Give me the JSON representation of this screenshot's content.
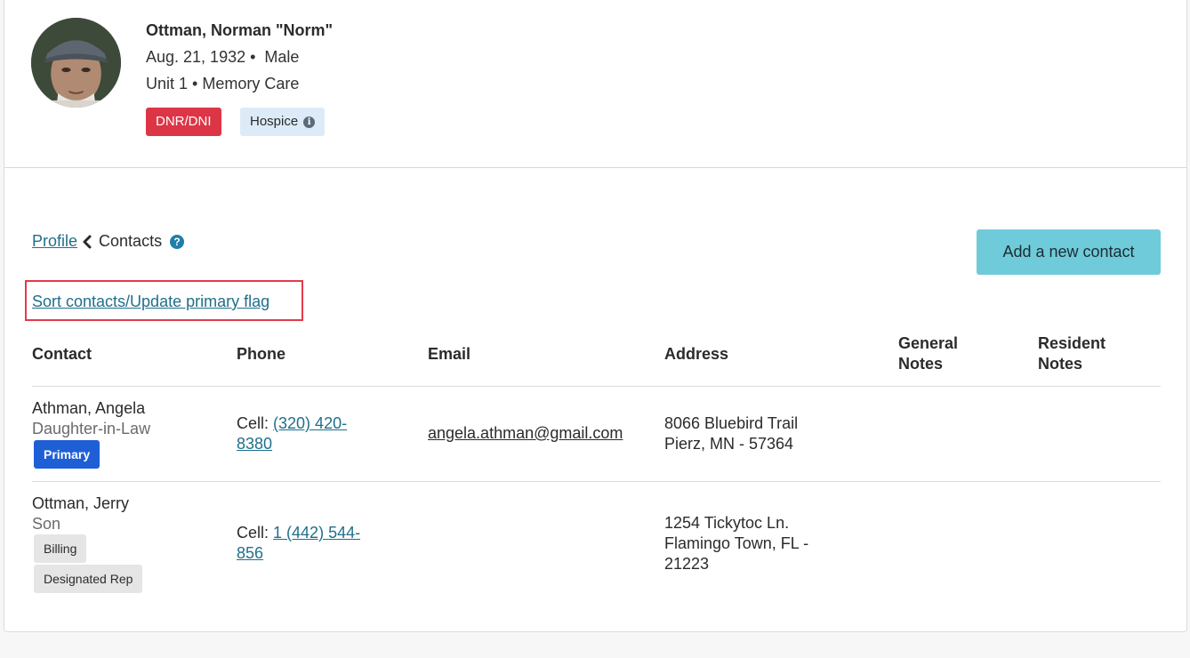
{
  "resident": {
    "name": "Ottman, Norman \"Norm\"",
    "dob": "Aug. 21, 1932",
    "sex": "Male",
    "location": "Unit 1 • Memory Care",
    "tags": {
      "dnr": "DNR/DNI",
      "hospice": "Hospice"
    }
  },
  "breadcrumb": {
    "parent": "Profile",
    "current": "Contacts"
  },
  "actions": {
    "add_contact": "Add a new contact",
    "sort": "Sort contacts/Update primary flag"
  },
  "table": {
    "headers": {
      "contact": "Contact",
      "phone": "Phone",
      "email": "Email",
      "address": "Address",
      "general_notes_1": "General",
      "general_notes_2": "Notes",
      "resident_notes_1": "Resident",
      "resident_notes_2": "Notes"
    },
    "rows": [
      {
        "name": "Athman, Angela",
        "relation": "Daughter-in-Law",
        "flags": [
          "Primary"
        ],
        "phone_label": "Cell:",
        "phone_line1": "(320) 420-",
        "phone_line2": "8380",
        "email": "angela.athman@gmail.com",
        "address_line1": "8066 Bluebird Trail",
        "address_line2": "Pierz, MN - 57364"
      },
      {
        "name": "Ottman, Jerry",
        "relation": "Son",
        "flags": [
          "Billing",
          "Designated Rep"
        ],
        "phone_label": "Cell:",
        "phone_line1": "1 (442) 544-",
        "phone_line2": "856",
        "email": "",
        "address_line1": "1254 Tickytoc Ln.",
        "address_line2": "Flamingo Town, FL -",
        "address_line3": "21223"
      }
    ]
  },
  "colors": {
    "link": "#1f6f8b",
    "dnr_badge": "#dc3545",
    "hospice_badge": "#dcebf7",
    "primary_chip": "#1f5fd6",
    "add_button": "#6fcbd9",
    "highlight_box": "#e23b4a"
  }
}
